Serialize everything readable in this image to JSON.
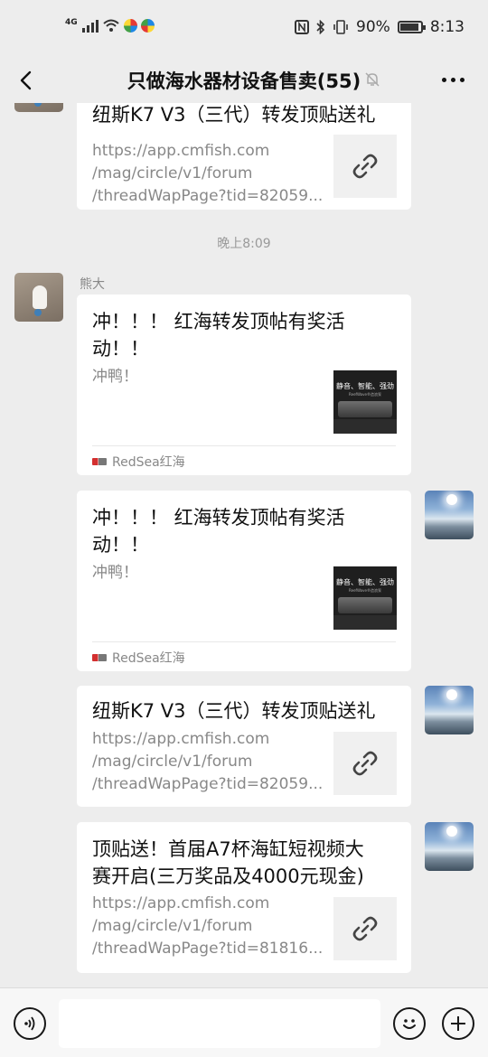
{
  "status_bar": {
    "network": "4G",
    "battery": "90%",
    "battery_level": 0.9,
    "time": "8:13"
  },
  "nav": {
    "title": "只做海水器材设备售卖(55)"
  },
  "messages": {
    "m1": {
      "title": "纽斯K7 V3（三代）转发顶贴送礼",
      "url_lines": [
        "https://app.cmfish.com",
        "/mag/circle/v1/forum",
        "/threadWapPage?tid=82059..."
      ]
    },
    "timestamp": "晚上8:09",
    "m2": {
      "sender": "熊大",
      "title_lines": [
        "冲！！！ 红海转发顶帖有奖活",
        "动！！"
      ],
      "desc": "冲鸭！",
      "thumb_text": "静音、智能、强劲",
      "thumb_sub": "ReefWave®造浪泵",
      "source": "RedSea红海"
    },
    "m3": {
      "title_lines": [
        "冲！！！ 红海转发顶帖有奖活",
        "动！！"
      ],
      "desc": "冲鸭！",
      "thumb_text": "静音、智能、强劲",
      "thumb_sub": "ReefWave®造浪泵",
      "source": "RedSea红海"
    },
    "m4": {
      "title": "纽斯K7 V3（三代）转发顶贴送礼",
      "url_lines": [
        "https://app.cmfish.com",
        "/mag/circle/v1/forum",
        "/threadWapPage?tid=82059..."
      ]
    },
    "m5": {
      "title_lines": [
        "顶贴送！首届A7杯海缸短视频大",
        "赛开启(三万奖品及4000元现金)"
      ],
      "url_lines": [
        "https://app.cmfish.com",
        "/mag/circle/v1/forum",
        "/threadWapPage?tid=81816..."
      ]
    }
  },
  "input_bar": {
    "placeholder": ""
  },
  "icons": {
    "back": "back-arrow-icon",
    "mute": "bell-off-icon",
    "more": "more-dots-icon",
    "link": "link-chain-icon",
    "voice": "voice-icon",
    "emoji": "emoji-icon",
    "plus": "plus-icon"
  }
}
